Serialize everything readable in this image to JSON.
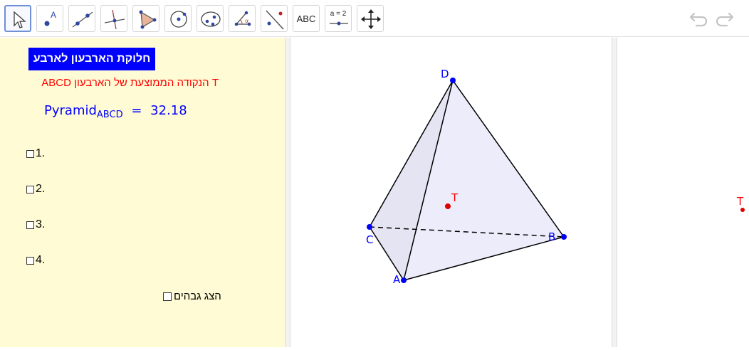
{
  "toolbar": {
    "tools": [
      {
        "name": "move-tool",
        "icon": "arrow-pointer-icon"
      },
      {
        "name": "point-tool",
        "icon": "point-a-icon"
      },
      {
        "name": "line-tool",
        "icon": "line-through-two-points-icon"
      },
      {
        "name": "perpendicular-line-tool",
        "icon": "perpendicular-line-icon"
      },
      {
        "name": "polygon-tool",
        "icon": "polygon-icon"
      },
      {
        "name": "circle-tool",
        "icon": "circle-center-point-icon"
      },
      {
        "name": "ellipse-tool",
        "icon": "ellipse-icon"
      },
      {
        "name": "angle-tool",
        "icon": "angle-icon"
      },
      {
        "name": "reflect-tool",
        "icon": "reflect-about-line-icon"
      },
      {
        "name": "text-tool",
        "icon": "text-icon",
        "label": "ABC"
      },
      {
        "name": "slider-tool",
        "icon": "slider-icon",
        "label": "a = 2"
      },
      {
        "name": "move-graphics-tool",
        "icon": "move-graphics-view-icon"
      }
    ],
    "undo_icon": "undo-icon",
    "redo_icon": "redo-icon"
  },
  "algebra": {
    "title_button": "חלוקת הארבעון לארבע",
    "description": "T הנקודה הממוצעת של הארבעון ABCD",
    "pyramid_name": "Pyramid",
    "pyramid_sub": "ABCD",
    "pyramid_eq": "=",
    "pyramid_value": "32.18",
    "checkboxes": [
      {
        "label": "1.",
        "checked": false
      },
      {
        "label": "2.",
        "checked": false
      },
      {
        "label": "3.",
        "checked": false
      },
      {
        "label": "4.",
        "checked": false
      }
    ],
    "show_heights": {
      "label": "הצג גבהים",
      "checked": false
    }
  },
  "graphics": {
    "points": {
      "A": "A",
      "B": "B",
      "C": "C",
      "D": "D",
      "T": "T"
    },
    "colors": {
      "point": "#0000ff",
      "label": "#0000ff",
      "t_point": "#ff0000",
      "face": "#e8e8f8"
    }
  },
  "graphics2": {
    "t_label": "T"
  },
  "colors": {
    "algebra_bg": "#fffbd4",
    "title_bg": "#0000ff",
    "description": "#ff0000",
    "value_text": "#0000ff",
    "active_tool_border": "#6f8fd6"
  }
}
